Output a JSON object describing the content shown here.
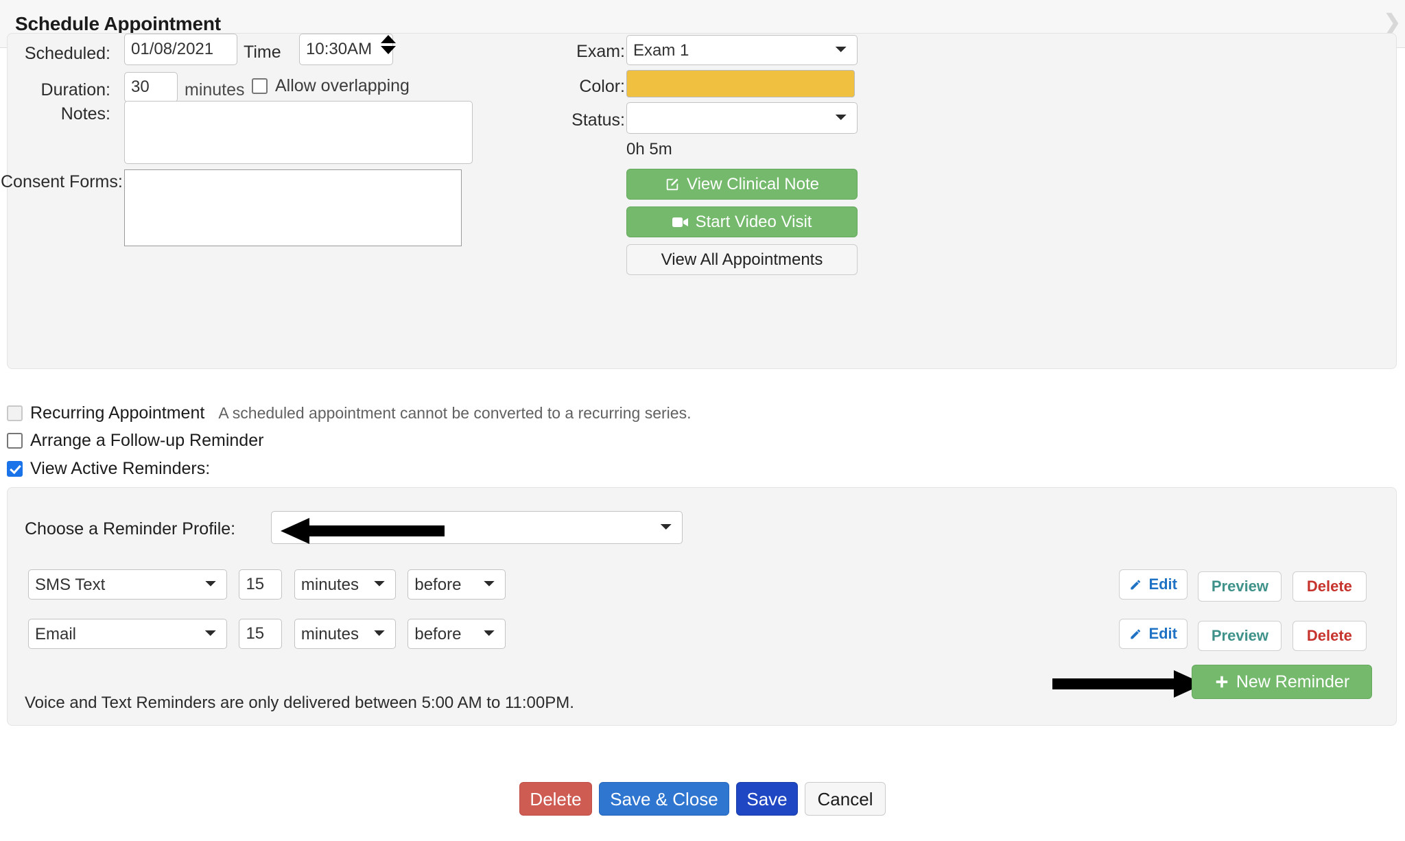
{
  "header": {
    "title": "Schedule Appointment",
    "chevron_icon": "chevron-right-icon"
  },
  "appointment": {
    "scheduled_label": "Scheduled:",
    "scheduled_date": "01/08/2021",
    "time_label": "Time",
    "time_value": "10:30AM",
    "time_spinner_icon": "spinner-updown-icon",
    "duration_label": "Duration:",
    "duration_value": "30",
    "duration_unit": "minutes",
    "allow_overlapping_label": "Allow overlapping",
    "allow_overlapping_checked": false,
    "notes_label": "Notes:",
    "notes_value": "",
    "consent_forms_label": "Consent Forms:",
    "consent_forms_value": ""
  },
  "right_panel": {
    "exam_label": "Exam:",
    "exam_value": "Exam 1",
    "color_label": "Color:",
    "color_value": "#f0c040",
    "status_label": "Status:",
    "status_value": "",
    "elapsed": "0h 5m",
    "view_clinical_note": "View Clinical Note",
    "view_clinical_note_icon": "pencil-square-icon",
    "start_video_visit": "Start Video Visit",
    "start_video_visit_icon": "video-camera-icon",
    "view_all_appointments": "View All Appointments"
  },
  "options": {
    "recurring_label": "Recurring Appointment",
    "recurring_checked": false,
    "recurring_disabled": true,
    "recurring_note": "A scheduled appointment cannot be converted to a recurring series.",
    "followup_label": "Arrange a Follow-up Reminder",
    "followup_checked": false,
    "view_active_label": "View Active Reminders:",
    "view_active_checked": true
  },
  "reminders": {
    "profile_label": "Choose a Reminder Profile:",
    "profile_value": "",
    "rows": [
      {
        "type": "SMS Text",
        "amount": "15",
        "unit": "minutes",
        "relation": "before",
        "edit": "Edit",
        "edit_icon": "pencil-icon",
        "preview": "Preview",
        "delete": "Delete"
      },
      {
        "type": "Email",
        "amount": "15",
        "unit": "minutes",
        "relation": "before",
        "edit": "Edit",
        "edit_icon": "pencil-icon",
        "preview": "Preview",
        "delete": "Delete"
      }
    ],
    "new_reminder_label": "New Reminder",
    "new_reminder_icon": "plus-icon",
    "delivery_note": "Voice and Text Reminders are only delivered between 5:00 AM to 11:00PM."
  },
  "footer": {
    "delete": "Delete",
    "save_close": "Save & Close",
    "save": "Save",
    "cancel": "Cancel"
  }
}
